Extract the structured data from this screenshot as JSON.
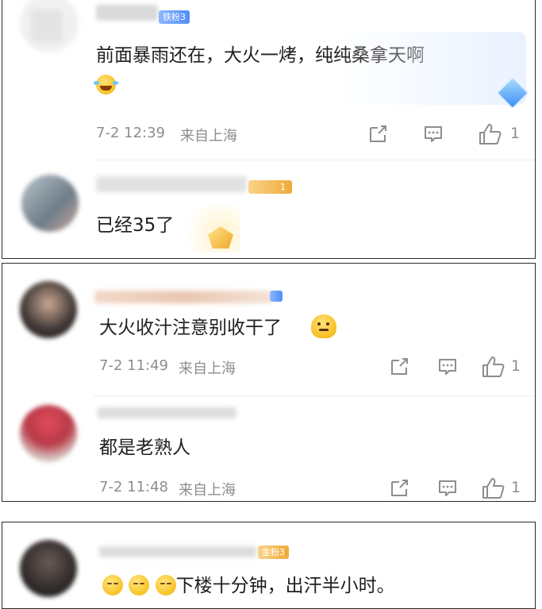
{
  "comments": [
    {
      "badge": "铁粉3",
      "text": "前面暴雨还在，大火一烤，纯纯桑拿天啊",
      "time": "7-2 12:39",
      "location": "来自上海",
      "likes": "1"
    },
    {
      "badge": "1",
      "text": "已经35了"
    },
    {
      "badge": "",
      "text": "大火收汁注意别收干了",
      "time": "7-2 11:49",
      "location": "来自上海",
      "likes": "1"
    },
    {
      "text": "都是老熟人",
      "time": "7-2 11:48",
      "location": "来自上海",
      "likes": "1"
    },
    {
      "badge": "金粉3",
      "text": "下楼十分钟，出汗半小时。"
    }
  ],
  "icons": {
    "share": "share-icon",
    "comment": "comment-icon",
    "like": "thumb-up-icon"
  }
}
